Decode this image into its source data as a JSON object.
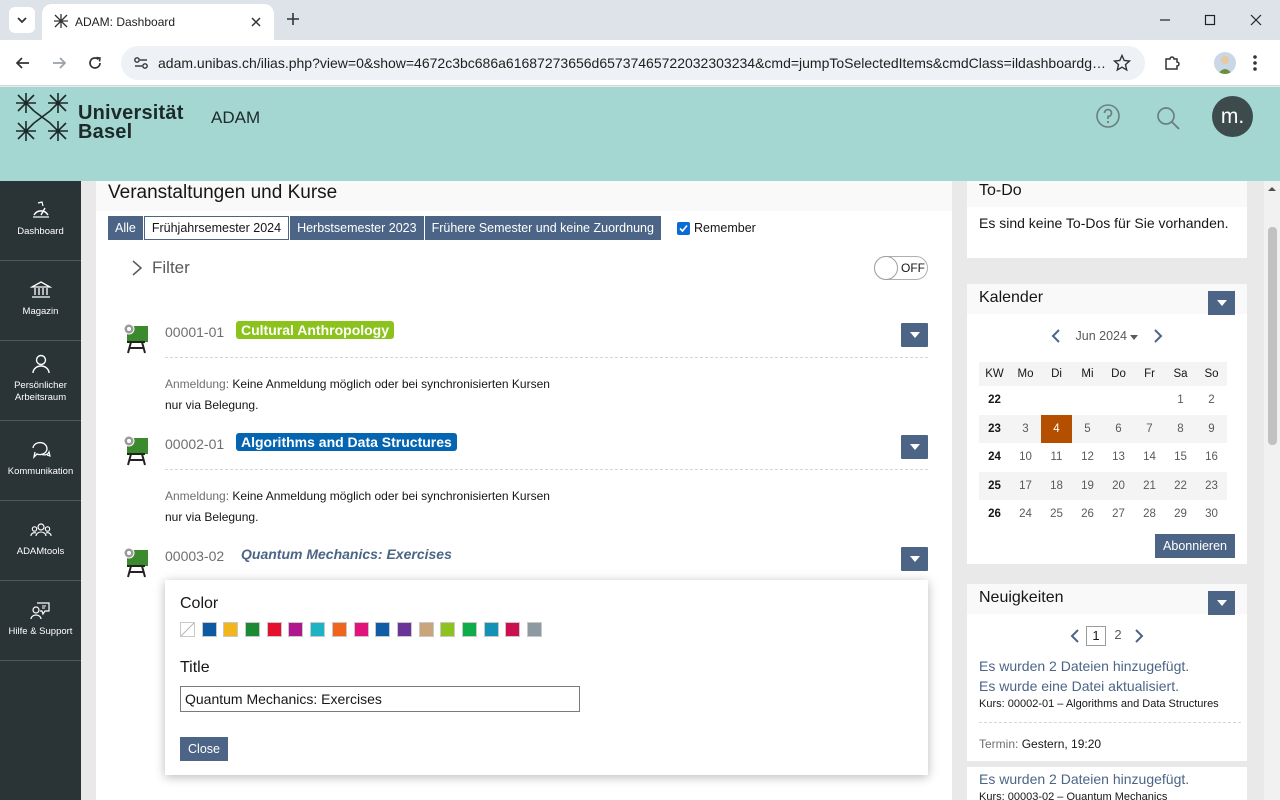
{
  "browser": {
    "tab_title": "ADAM: Dashboard",
    "url": "adam.unibas.ch/ilias.php?view=0&show=4672c3bc686a61687273656d65737465722032303234&cmd=jumpToSelectedItems&cmdClass=ildashboardgui..."
  },
  "header": {
    "university_line1": "Universität",
    "university_line2": "Basel",
    "app_name": "ADAM",
    "avatar_text": "m."
  },
  "mainbar": [
    {
      "label": "Dashboard",
      "icon": "dashboard-icon"
    },
    {
      "label": "Magazin",
      "icon": "repository-icon"
    },
    {
      "label": "Persönlicher Arbeitsraum",
      "icon": "person-icon"
    },
    {
      "label": "Kommunikation",
      "icon": "chat-icon"
    },
    {
      "label": "ADAMtools",
      "icon": "users-icon"
    },
    {
      "label": "Hilfe & Support",
      "icon": "support-icon"
    }
  ],
  "main": {
    "title": "Veranstaltungen und Kurse",
    "view_tabs": [
      "Alle",
      "Frühjahrsemester 2024",
      "Herbstsemester 2023",
      "Frühere Semester und keine Zuordnung"
    ],
    "active_tab": "Frühjahrsemester 2024",
    "remember_label": "Remember",
    "filter_label": "Filter",
    "toggle_label": "OFF",
    "courses": [
      {
        "number": "00001-01",
        "title": "Cultural Anthropology",
        "color": "#8cc21c",
        "prop_key": "Anmeldung:",
        "prop_value": "Keine Anmeldung möglich oder bei synchronisierten Kursen nur via Belegung."
      },
      {
        "number": "00002-01",
        "title": "Algorithms and Data Structures",
        "color": "#0565b0",
        "prop_key": "Anmeldung:",
        "prop_value": "Keine Anmeldung möglich oder bei synchronisierten Kursen nur via Belegung."
      },
      {
        "number": "00003-02",
        "title": "Quantum Mechanics: Exercises",
        "color": ""
      }
    ]
  },
  "popover": {
    "color_label": "Color",
    "swatches": [
      "none",
      "#0b5aa3",
      "#f2b51c",
      "#1a8a34",
      "#e3112d",
      "#b0168e",
      "#1eb3c3",
      "#f1641e",
      "#e2147b",
      "#0e5da6",
      "#6a3599",
      "#c9a57b",
      "#8ec31f",
      "#0ead49",
      "#1392b6",
      "#cc0f4f",
      "#8e9aa1"
    ],
    "title_label": "Title",
    "title_value": "Quantum Mechanics: Exercises",
    "close_label": "Close"
  },
  "todo": {
    "title": "To-Do",
    "text": "Es sind keine To-Dos für Sie vorhanden."
  },
  "calendar": {
    "title": "Kalender",
    "month": "Jun 2024",
    "headers": [
      "KW",
      "Mo",
      "Di",
      "Mi",
      "Do",
      "Fr",
      "Sa",
      "So"
    ],
    "rows": [
      [
        "22",
        "",
        "",
        "",
        "",
        "",
        "1",
        "2"
      ],
      [
        "23",
        "3",
        "4",
        "5",
        "6",
        "7",
        "8",
        "9"
      ],
      [
        "24",
        "10",
        "11",
        "12",
        "13",
        "14",
        "15",
        "16"
      ],
      [
        "25",
        "17",
        "18",
        "19",
        "20",
        "21",
        "22",
        "23"
      ],
      [
        "26",
        "24",
        "25",
        "26",
        "27",
        "28",
        "29",
        "30"
      ]
    ],
    "today": "4",
    "subscribe_label": "Abonnieren"
  },
  "news": {
    "title": "Neuigkeiten",
    "pages": [
      "1",
      "2"
    ],
    "current_page": "1",
    "items": [
      {
        "line1": "Es wurden 2 Dateien hinzugefügt.",
        "line2": "Es wurde eine Datei aktualisiert.",
        "meta": "Kurs: 00002-01 – Algorithms and Data Structures"
      },
      {
        "time_key": "Termin:",
        "time_value": "Gestern, 19:20"
      },
      {
        "line1": "Es wurden 2 Dateien hinzugefügt.",
        "meta": "Kurs: 00003-02 – Quantum Mechanics"
      }
    ]
  }
}
